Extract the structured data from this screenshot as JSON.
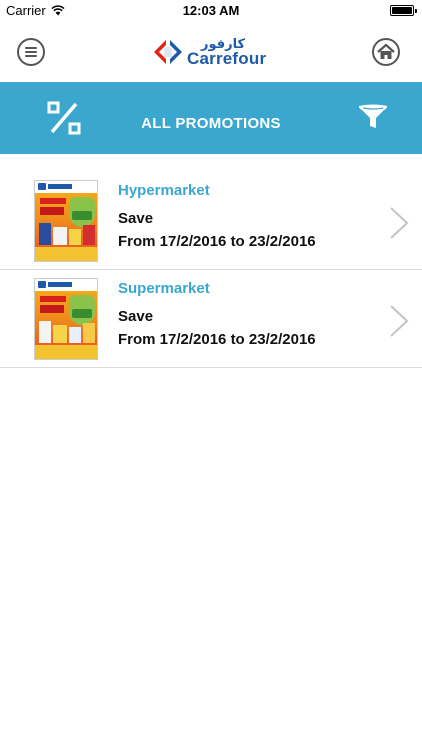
{
  "status": {
    "carrier": "Carrier",
    "time": "12:03 AM"
  },
  "header": {
    "logo_arabic": "كارفور",
    "logo_name": "Carrefour",
    "menu_icon": "menu-icon",
    "home_icon": "home-icon"
  },
  "promo_bar": {
    "title": "ALL PROMOTIONS",
    "left_icon": "percent-icon",
    "right_icon": "filter-icon"
  },
  "promotions": [
    {
      "store": "Hypermarket",
      "name": "Save",
      "dates": "From 17/2/2016 to 23/2/2016"
    },
    {
      "store": "Supermarket",
      "name": "Save",
      "dates": "From 17/2/2016 to 23/2/2016"
    }
  ],
  "colors": {
    "accent": "#3ba7cf",
    "brand_blue": "#1e5aa8",
    "brand_red": "#e2231a"
  }
}
